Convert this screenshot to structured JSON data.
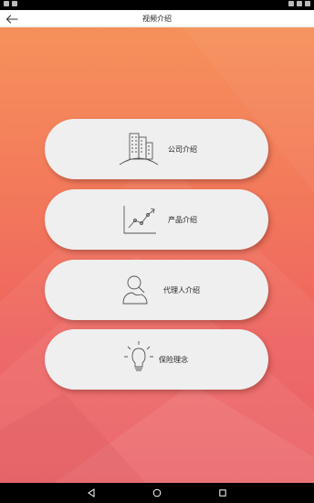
{
  "header": {
    "title": "视频介绍",
    "back_icon": "arrow-left-icon"
  },
  "menu": {
    "items": [
      {
        "label": "公司介绍",
        "icon": "building-icon"
      },
      {
        "label": "产品介绍",
        "icon": "line-chart-icon"
      },
      {
        "label": "代理人介绍",
        "icon": "person-search-icon"
      },
      {
        "label": "保险理念",
        "icon": "lightbulb-icon"
      }
    ]
  },
  "navbar": {
    "back_icon": "nav-back-icon",
    "home_icon": "nav-home-icon",
    "recents_icon": "nav-recents-icon"
  },
  "colors": {
    "gradient_top": "#f6915b",
    "gradient_bottom": "#e8585d",
    "card": "#efefef",
    "icon_stroke": "#555555"
  }
}
